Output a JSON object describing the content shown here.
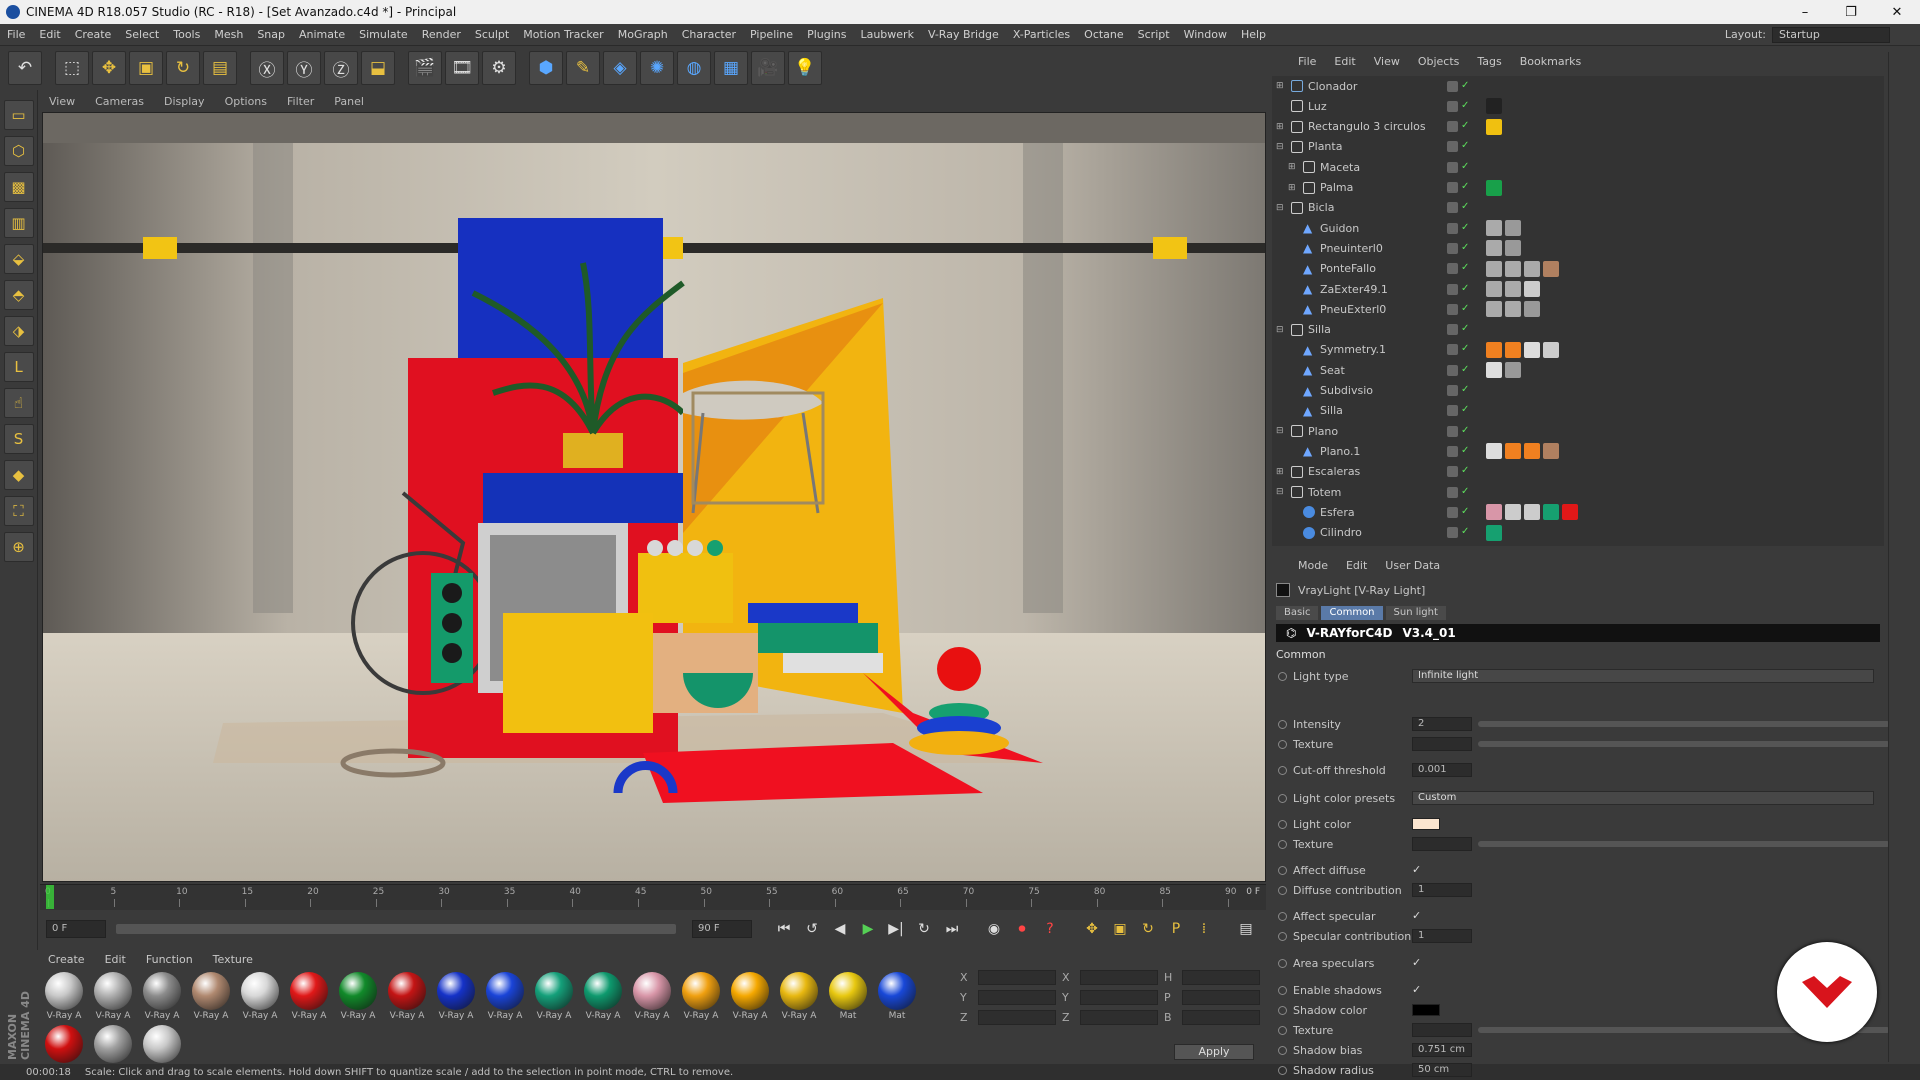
{
  "title_bar": {
    "title": "CINEMA 4D R18.057 Studio (RC - R18) - [Set Avanzado.c4d *] - Principal"
  },
  "menu": [
    "File",
    "Edit",
    "Create",
    "Select",
    "Tools",
    "Mesh",
    "Snap",
    "Animate",
    "Simulate",
    "Render",
    "Sculpt",
    "Motion Tracker",
    "MoGraph",
    "Character",
    "Pipeline",
    "Plugins",
    "Laubwerk",
    "V-Ray Bridge",
    "X-Particles",
    "Octane",
    "Script",
    "Window",
    "Help"
  ],
  "layout": {
    "label": "Layout:",
    "value": "Startup"
  },
  "viewport_menu": [
    "View",
    "Cameras",
    "Display",
    "Options",
    "Filter",
    "Panel"
  ],
  "timeline": {
    "ticks": [
      "0",
      "5",
      "10",
      "15",
      "20",
      "25",
      "30",
      "35",
      "40",
      "45",
      "50",
      "55",
      "60",
      "65",
      "70",
      "75",
      "80",
      "85",
      "90"
    ],
    "end_label": "0 F",
    "start_frame": "0 F",
    "end_frame": "90 F"
  },
  "material_menu": [
    "Create",
    "Edit",
    "Function",
    "Texture"
  ],
  "materials": [
    {
      "label": "V-Ray A",
      "color": "#c9c9c9"
    },
    {
      "label": "V-Ray A",
      "color": "#b0b0b0"
    },
    {
      "label": "V-Ray A",
      "color": "#8c8c8c"
    },
    {
      "label": "V-Ray A",
      "color": "#b08970"
    },
    {
      "label": "V-Ray A",
      "color": "#d8d8d8"
    },
    {
      "label": "V-Ray A",
      "color": "#e01818"
    },
    {
      "label": "V-Ray A",
      "color": "#118a2a"
    },
    {
      "label": "V-Ray A",
      "color": "#c41414"
    },
    {
      "label": "V-Ray A",
      "color": "#1532c8"
    },
    {
      "label": "V-Ray A",
      "color": "#1a44d8"
    },
    {
      "label": "V-Ray A",
      "color": "#14a07a"
    },
    {
      "label": "V-Ray A",
      "color": "#0e9a6e"
    },
    {
      "label": "V-Ray A",
      "color": "#d896a8"
    },
    {
      "label": "V-Ray A",
      "color": "#f0a010"
    },
    {
      "label": "V-Ray A",
      "color": "#f5a800"
    },
    {
      "label": "V-Ray A",
      "color": "#e8b810"
    },
    {
      "label": "Mat",
      "color": "#e8c810"
    },
    {
      "label": "Mat",
      "color": "#1848d8"
    },
    {
      "label": "",
      "color": "#d01010"
    },
    {
      "label": "",
      "color": "#a0a0a0"
    },
    {
      "label": "",
      "color": "#c8c8c8"
    }
  ],
  "coords": {
    "apply_label": "Apply",
    "labels": [
      "X",
      "Y",
      "Z"
    ],
    "labels2": [
      "X",
      "Y",
      "Z"
    ],
    "labels3": [
      "H",
      "P",
      "B"
    ]
  },
  "status": {
    "time": "00:00:18",
    "message": "Scale: Click and drag to scale elements. Hold down SHIFT to quantize scale / add to the selection in point mode, CTRL to remove."
  },
  "object_menu": [
    "File",
    "Edit",
    "View",
    "Objects",
    "Tags",
    "Bookmarks"
  ],
  "objects": [
    {
      "name": "Clonador",
      "depth": 0,
      "fold": "+",
      "icon": "cloner"
    },
    {
      "name": "Luz",
      "depth": 0,
      "fold": "",
      "icon": "light"
    },
    {
      "name": "Rectangulo 3 circulos",
      "depth": 0,
      "fold": "+",
      "icon": "null"
    },
    {
      "name": "Planta",
      "depth": 0,
      "fold": "-",
      "icon": "null"
    },
    {
      "name": "Maceta",
      "depth": 1,
      "fold": "+",
      "icon": "null"
    },
    {
      "name": "Palma",
      "depth": 1,
      "fold": "+",
      "icon": "null"
    },
    {
      "name": "Bicla",
      "depth": 0,
      "fold": "-",
      "icon": "null"
    },
    {
      "name": "Guidon",
      "depth": 1,
      "fold": "",
      "icon": "bone"
    },
    {
      "name": "Pneuinterl0",
      "depth": 1,
      "fold": "",
      "icon": "bone"
    },
    {
      "name": "PonteFallo",
      "depth": 1,
      "fold": "",
      "icon": "bone"
    },
    {
      "name": "ZaExter49.1",
      "depth": 1,
      "fold": "",
      "icon": "bone"
    },
    {
      "name": "PneuExterl0",
      "depth": 1,
      "fold": "",
      "icon": "bone"
    },
    {
      "name": "Silla",
      "depth": 0,
      "fold": "-",
      "icon": "null"
    },
    {
      "name": "Symmetry.1",
      "depth": 1,
      "fold": "",
      "icon": "bone"
    },
    {
      "name": "Seat",
      "depth": 1,
      "fold": "",
      "icon": "bone"
    },
    {
      "name": "Subdivsio",
      "depth": 1,
      "fold": "",
      "icon": "bone"
    },
    {
      "name": "Silla",
      "depth": 1,
      "fold": "",
      "icon": "bone"
    },
    {
      "name": "Plano",
      "depth": 0,
      "fold": "-",
      "icon": "null"
    },
    {
      "name": "Plano.1",
      "depth": 1,
      "fold": "",
      "icon": "bone"
    },
    {
      "name": "Escaleras",
      "depth": 0,
      "fold": "+",
      "icon": "null"
    },
    {
      "name": "Totem",
      "depth": 0,
      "fold": "-",
      "icon": "null"
    },
    {
      "name": "Esfera",
      "depth": 1,
      "fold": "",
      "icon": "sphere"
    },
    {
      "name": "Cilindro",
      "depth": 1,
      "fold": "",
      "icon": "sphere"
    }
  ],
  "attr_menu": [
    "Mode",
    "Edit",
    "User Data"
  ],
  "attr": {
    "object_title": "VrayLight [V-Ray Light]",
    "tabs": [
      "Basic",
      "Common",
      "Sun light"
    ],
    "banner": "V-RAYforC4D",
    "version": "V3.4_01",
    "section": "Common",
    "rows": [
      {
        "label": "Light type",
        "kind": "dropdown",
        "value": "Infinite light"
      },
      {
        "label": "Intensity",
        "kind": "slider",
        "value": "2"
      },
      {
        "label": "Texture",
        "kind": "slider",
        "value": ""
      },
      {
        "label": "Cut-off threshold",
        "kind": "field",
        "value": "0.001"
      },
      {
        "label": "Light color presets",
        "kind": "dropdown",
        "value": "Custom"
      },
      {
        "label": "Light color",
        "kind": "color",
        "value": "#fbe5cf"
      },
      {
        "label": "Texture",
        "kind": "slider",
        "value": ""
      },
      {
        "label": "Affect diffuse",
        "kind": "check",
        "value": "✓"
      },
      {
        "label": "Diffuse contribution",
        "kind": "field",
        "value": "1"
      },
      {
        "label": "Affect specular",
        "kind": "check",
        "value": "✓"
      },
      {
        "label": "Specular contribution",
        "kind": "field",
        "value": "1"
      },
      {
        "label": "Area speculars",
        "kind": "check",
        "value": "✓"
      },
      {
        "label": "Enable shadows",
        "kind": "check",
        "value": "✓"
      },
      {
        "label": "Shadow color",
        "kind": "color",
        "value": "#000000"
      },
      {
        "label": "Texture",
        "kind": "slider",
        "value": ""
      },
      {
        "label": "Shadow bias",
        "kind": "field",
        "value": "0.751 cm"
      },
      {
        "label": "Shadow radius",
        "kind": "field",
        "value": "50 cm"
      }
    ]
  }
}
